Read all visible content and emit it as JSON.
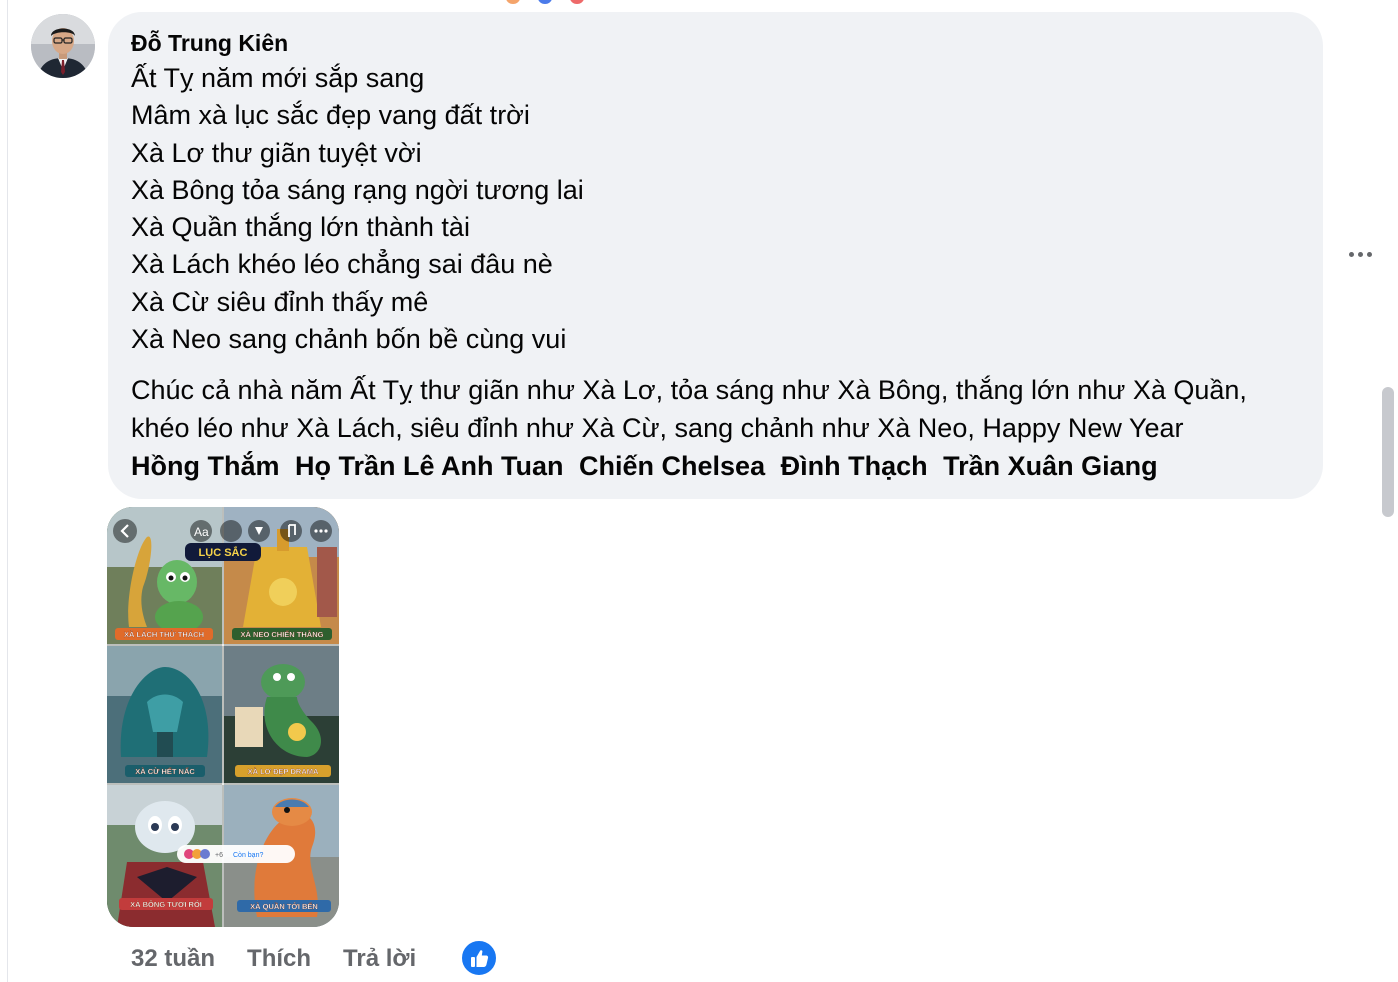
{
  "comment": {
    "author": "Đỗ Trung Kiên",
    "poem": [
      "Ất Tỵ năm mới sắp sang",
      "Mâm xà lục sắc đẹp vang đất trời",
      "Xà Lơ thư giãn tuyệt vời",
      "Xà Bông tỏa sáng rạng ngời tương lai",
      "Xà Quần thắng lớn thành tài",
      "Xà Lách khéo léo chẳng sai đâu nè",
      "Xà Cừ siêu đỉnh thấy mê",
      "Xà Neo sang chảnh bốn bề cùng vui"
    ],
    "wish": "Chúc cả nhà năm Ất Tỵ thư giãn như Xà Lơ, tỏa sáng như Xà Bông, thắng lớn như Xà Quần, khéo léo như Xà Lách, siêu đỉnh như Xà Cừ, sang chảnh như Xà Neo, Happy New Year",
    "tags": [
      "Hồng Thắm",
      "Họ Trần Lê Anh Tuan",
      "Chiến Chelsea",
      "Đình Thạch",
      "Trần Xuân Giang"
    ]
  },
  "media": {
    "header_text": "Aa",
    "logo_text": "LỤC SẮC",
    "captions": [
      "XÀ LÁCH THỬ THÁCH",
      "XÀ NEO CHIẾN THẮNG",
      "XÀ CỪ HẾT NẤC",
      "XÀ LƠ ĐẸP DRAMA",
      "XÀ BÔNG TƯƠI RÓI",
      "XÀ QUẦN TỚI BẾN"
    ],
    "pill_text": "Còn bạn?",
    "pill_count": "+6"
  },
  "actions": {
    "time": "32 tuần",
    "like": "Thích",
    "reply": "Trả lời"
  },
  "icons": {
    "more": "more-horizontal-icon",
    "reaction": "thumbs-up-icon"
  },
  "colors": {
    "bubble": "#f0f2f5",
    "secondary_text": "#65676b",
    "like_blue": "#1877f2"
  }
}
